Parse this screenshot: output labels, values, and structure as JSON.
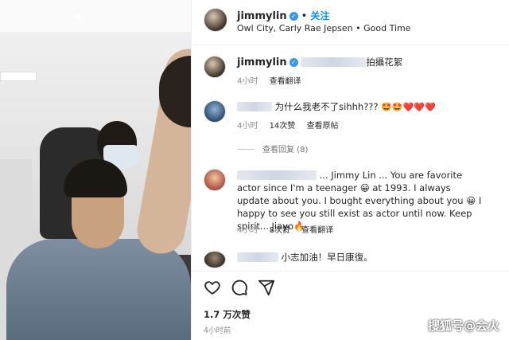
{
  "post": {
    "username": "jimmylin",
    "verified_icon": "verified-badge-icon",
    "follow_label": "关注",
    "separator": "•",
    "music": "Owl City, Carly Rae Jepsen • Good Time"
  },
  "caption": {
    "username": "jimmylin",
    "text": "拍攝花絮",
    "time": "4小时",
    "translate_label": "查看翻译"
  },
  "comments": [
    {
      "text": "为什么我老不了sihhh???",
      "emojis": "🤩🤩❤️❤️❤️",
      "time": "4小时",
      "likes": "14次赞",
      "action": "查看原帖",
      "view_replies": "查看回复 (8)"
    },
    {
      "text": "... Jimmy Lin ... You are favorite actor since I'm a teenager 😀 at 1993. I always update about you. I bought everything about you 😀 I happy to see you still exist as actor until now. Keep spirit... Jiayo🔥",
      "time": "4小时",
      "likes": "8次赞",
      "action": "查看翻译"
    },
    {
      "text": "小志加油！早日康復。"
    }
  ],
  "actions": {
    "like_icon": "heart-icon",
    "comment_icon": "comment-icon",
    "share_icon": "share-icon"
  },
  "likes_count": "1.7 万次赞",
  "post_age": "4小时前",
  "watermark": "搜狐号@会火",
  "colors": {
    "accent": "#0095f6",
    "verified": "#3897f0",
    "text": "#262626",
    "muted": "#8e8e8e"
  }
}
